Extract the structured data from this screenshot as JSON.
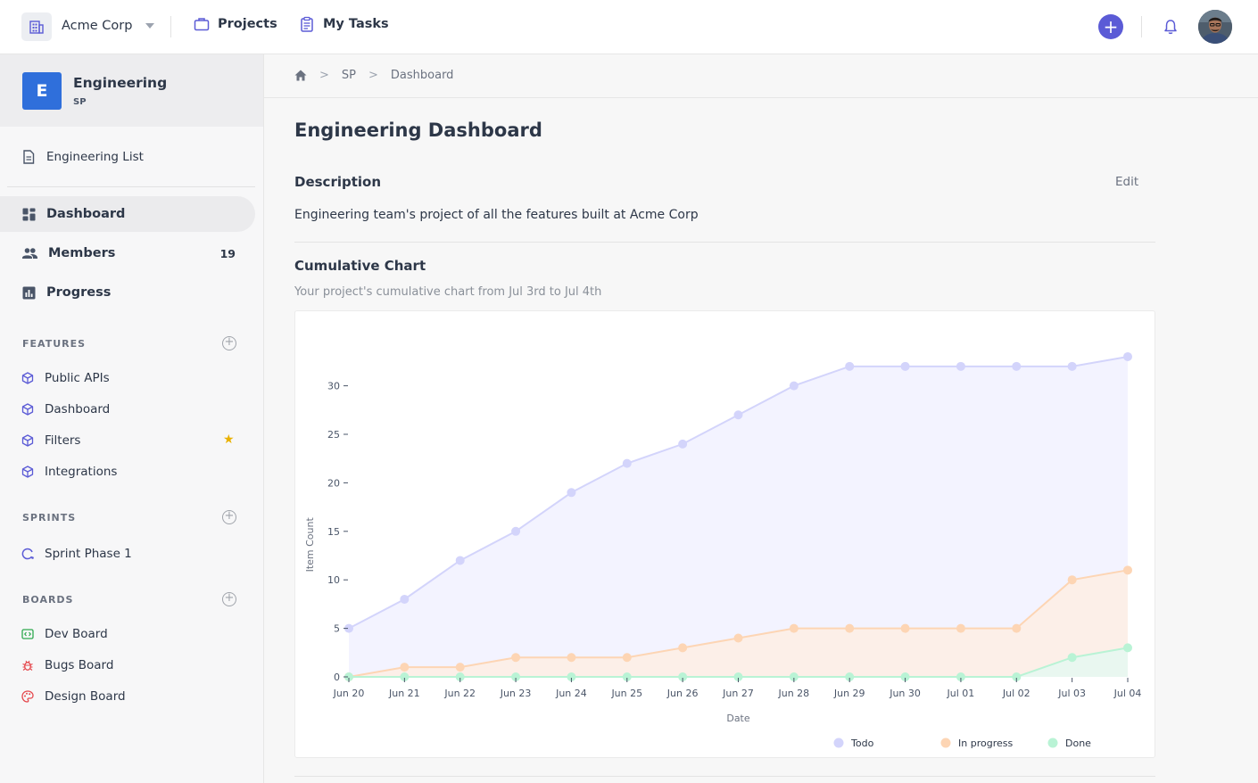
{
  "topbar": {
    "org_name": "Acme Corp",
    "nav": [
      {
        "label": "Projects",
        "icon": "briefcase-icon"
      },
      {
        "label": "My Tasks",
        "icon": "clipboard-icon"
      }
    ],
    "add_symbol": "+",
    "accent_color": "#5b5bd6"
  },
  "sidebar": {
    "project": {
      "badge": "E",
      "name": "Engineering",
      "key": "SP",
      "badge_color": "#2f6fdb"
    },
    "list_link": "Engineering List",
    "main_items": [
      {
        "label": "Dashboard",
        "icon": "dashboard-icon",
        "active": true
      },
      {
        "label": "Members",
        "icon": "people-icon",
        "count": "19"
      },
      {
        "label": "Progress",
        "icon": "bar-chart-icon"
      }
    ],
    "sections": {
      "features": {
        "title": "FEATURES",
        "items": [
          {
            "label": "Public APIs",
            "icon": "cube-icon"
          },
          {
            "label": "Dashboard",
            "icon": "cube-icon"
          },
          {
            "label": "Filters",
            "icon": "cube-icon",
            "starred": true
          },
          {
            "label": "Integrations",
            "icon": "cube-icon"
          }
        ]
      },
      "sprints": {
        "title": "SPRINTS",
        "items": [
          {
            "label": "Sprint Phase 1",
            "icon": "sprint-icon"
          }
        ]
      },
      "boards": {
        "title": "BOARDS",
        "items": [
          {
            "label": "Dev Board",
            "icon": "code-icon",
            "color": "#2fa84f"
          },
          {
            "label": "Bugs Board",
            "icon": "bug-icon",
            "color": "#e5484d"
          },
          {
            "label": "Design Board",
            "icon": "palette-icon",
            "color": "#e5484d"
          }
        ]
      }
    }
  },
  "breadcrumb": {
    "items": [
      "SP",
      "Dashboard"
    ]
  },
  "page": {
    "title": "Engineering Dashboard",
    "description_label": "Description",
    "edit_label": "Edit",
    "description": "Engineering team's project of all the features built at Acme Corp",
    "chart_title": "Cumulative Chart",
    "chart_subtitle": "Your project's cumulative chart from Jul 3rd to Jul 4th"
  },
  "chart_data": {
    "type": "area",
    "x": [
      "Jun 20",
      "Jun 21",
      "Jun 22",
      "Jun 23",
      "Jun 24",
      "Jun 25",
      "Jun 26",
      "Jun 27",
      "Jun 28",
      "Jun 29",
      "Jun 30",
      "Jul 01",
      "Jul 02",
      "Jul 03",
      "Jul 04"
    ],
    "series": [
      {
        "name": "Todo",
        "color": "#d3d4fb",
        "fill": "#f3f3ff",
        "values": [
          5,
          8,
          12,
          15,
          19,
          22,
          24,
          27,
          30,
          32,
          32,
          32,
          32,
          32,
          33
        ]
      },
      {
        "name": "In progress",
        "color": "#fdd5b4",
        "fill": "#fcefe8",
        "values": [
          0,
          1,
          1,
          2,
          2,
          2,
          3,
          4,
          5,
          5,
          5,
          5,
          5,
          10,
          11
        ]
      },
      {
        "name": "Done",
        "color": "#b9f3d5",
        "fill": "#e9f7f0",
        "values": [
          0,
          0,
          0,
          0,
          0,
          0,
          0,
          0,
          0,
          0,
          0,
          0,
          0,
          2,
          3
        ]
      }
    ],
    "xlabel": "Date",
    "ylabel": "Item Count",
    "yticks": [
      0,
      5,
      10,
      15,
      20,
      25,
      30
    ],
    "ylim": [
      0,
      33
    ],
    "legend": "bottom-right",
    "grid": false
  }
}
